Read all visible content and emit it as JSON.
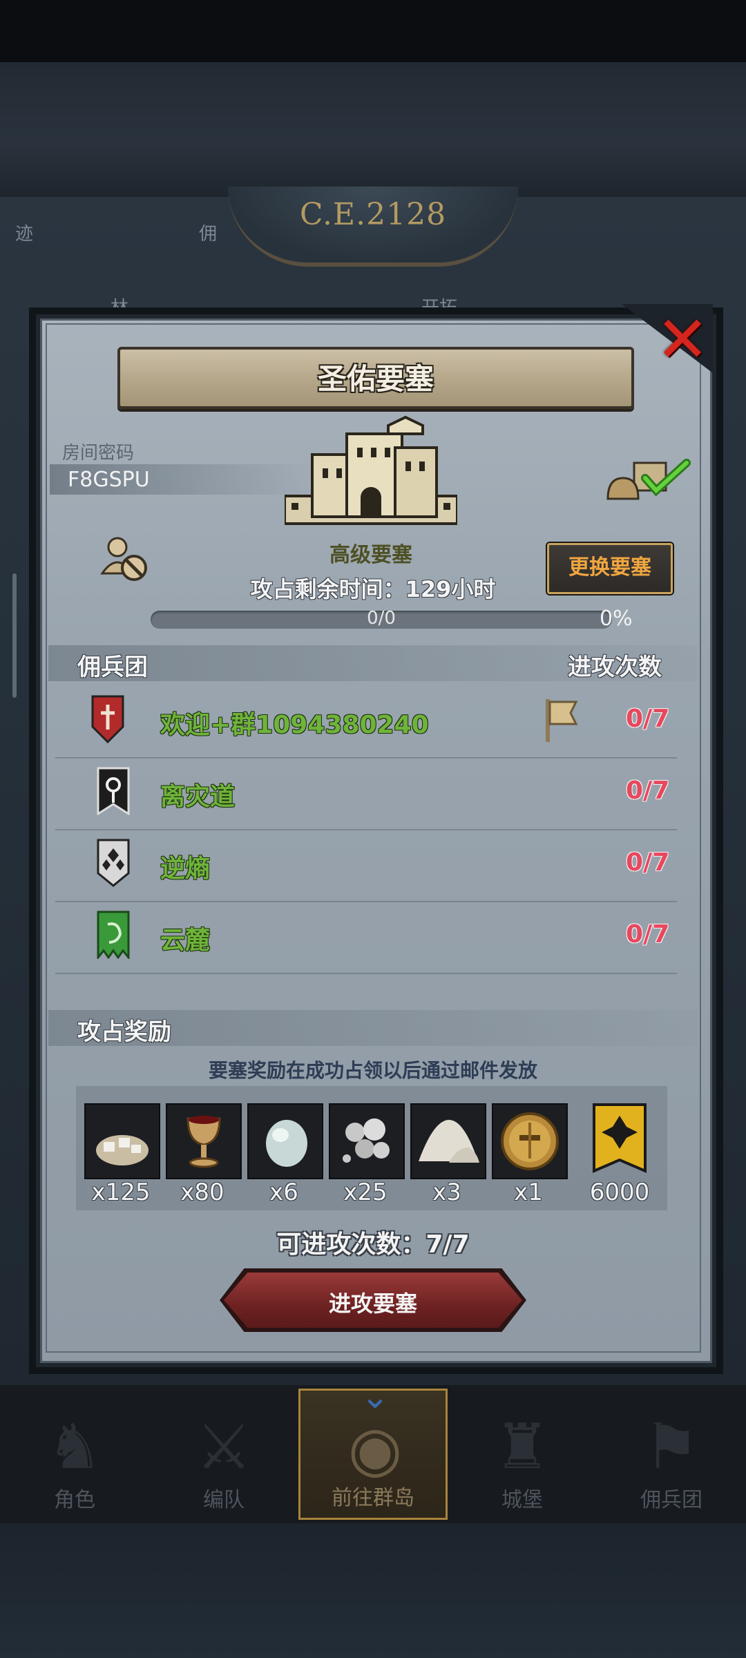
{
  "background": {
    "era": "C.E.2128",
    "tabs": [
      "迹",
      "佣",
      "林",
      "开拓"
    ]
  },
  "dialog": {
    "title": "圣佑要塞",
    "room_label": "房间密码",
    "room_code": "F8GSPU",
    "fortress_level": "高级要塞",
    "change_button": "更换要塞",
    "remaining_label": "攻占剩余时间：",
    "remaining_value": "129",
    "remaining_unit": "小时",
    "progress_count": "0/0",
    "progress_percent": "0%",
    "progress_fraction": 0,
    "mercs_header": "佣兵团",
    "attacks_header": "进攻次数",
    "guilds": [
      {
        "name": "欢迎+群1094380240",
        "count": "0/7",
        "banner_color": "#b22a2a",
        "has_flag": true
      },
      {
        "name": "离灾道",
        "count": "0/7",
        "banner_color": "#222222",
        "has_flag": false
      },
      {
        "name": "逆熵",
        "count": "0/7",
        "banner_color": "#d8d8d8",
        "has_flag": false
      },
      {
        "name": "云麓",
        "count": "0/7",
        "banner_color": "#3a9a3a",
        "has_flag": false
      }
    ],
    "reward_header": "攻占奖励",
    "reward_note": "要塞奖励在成功占领以后通过邮件发放",
    "rewards": [
      {
        "icon": "stone-pile-icon",
        "qty": "x125"
      },
      {
        "icon": "goblet-icon",
        "qty": "x80"
      },
      {
        "icon": "moonstone-icon",
        "qty": "x6"
      },
      {
        "icon": "silver-ore-icon",
        "qty": "x25"
      },
      {
        "icon": "salt-pile-icon",
        "qty": "x3"
      },
      {
        "icon": "gold-helmet-icon",
        "qty": "x1"
      },
      {
        "icon": "gold-banner-icon",
        "qty": "6000"
      }
    ],
    "attacks_left": "可进攻次数：7/7",
    "attack_button": "进攻要塞"
  },
  "nav": [
    {
      "label": "角色",
      "icon": "knight-icon"
    },
    {
      "label": "编队",
      "icon": "formation-icon"
    },
    {
      "label": "前往群岛",
      "icon": "globe-icon",
      "active": true
    },
    {
      "label": "城堡",
      "icon": "castle-icon"
    },
    {
      "label": "佣兵团",
      "icon": "mercenary-icon"
    }
  ]
}
